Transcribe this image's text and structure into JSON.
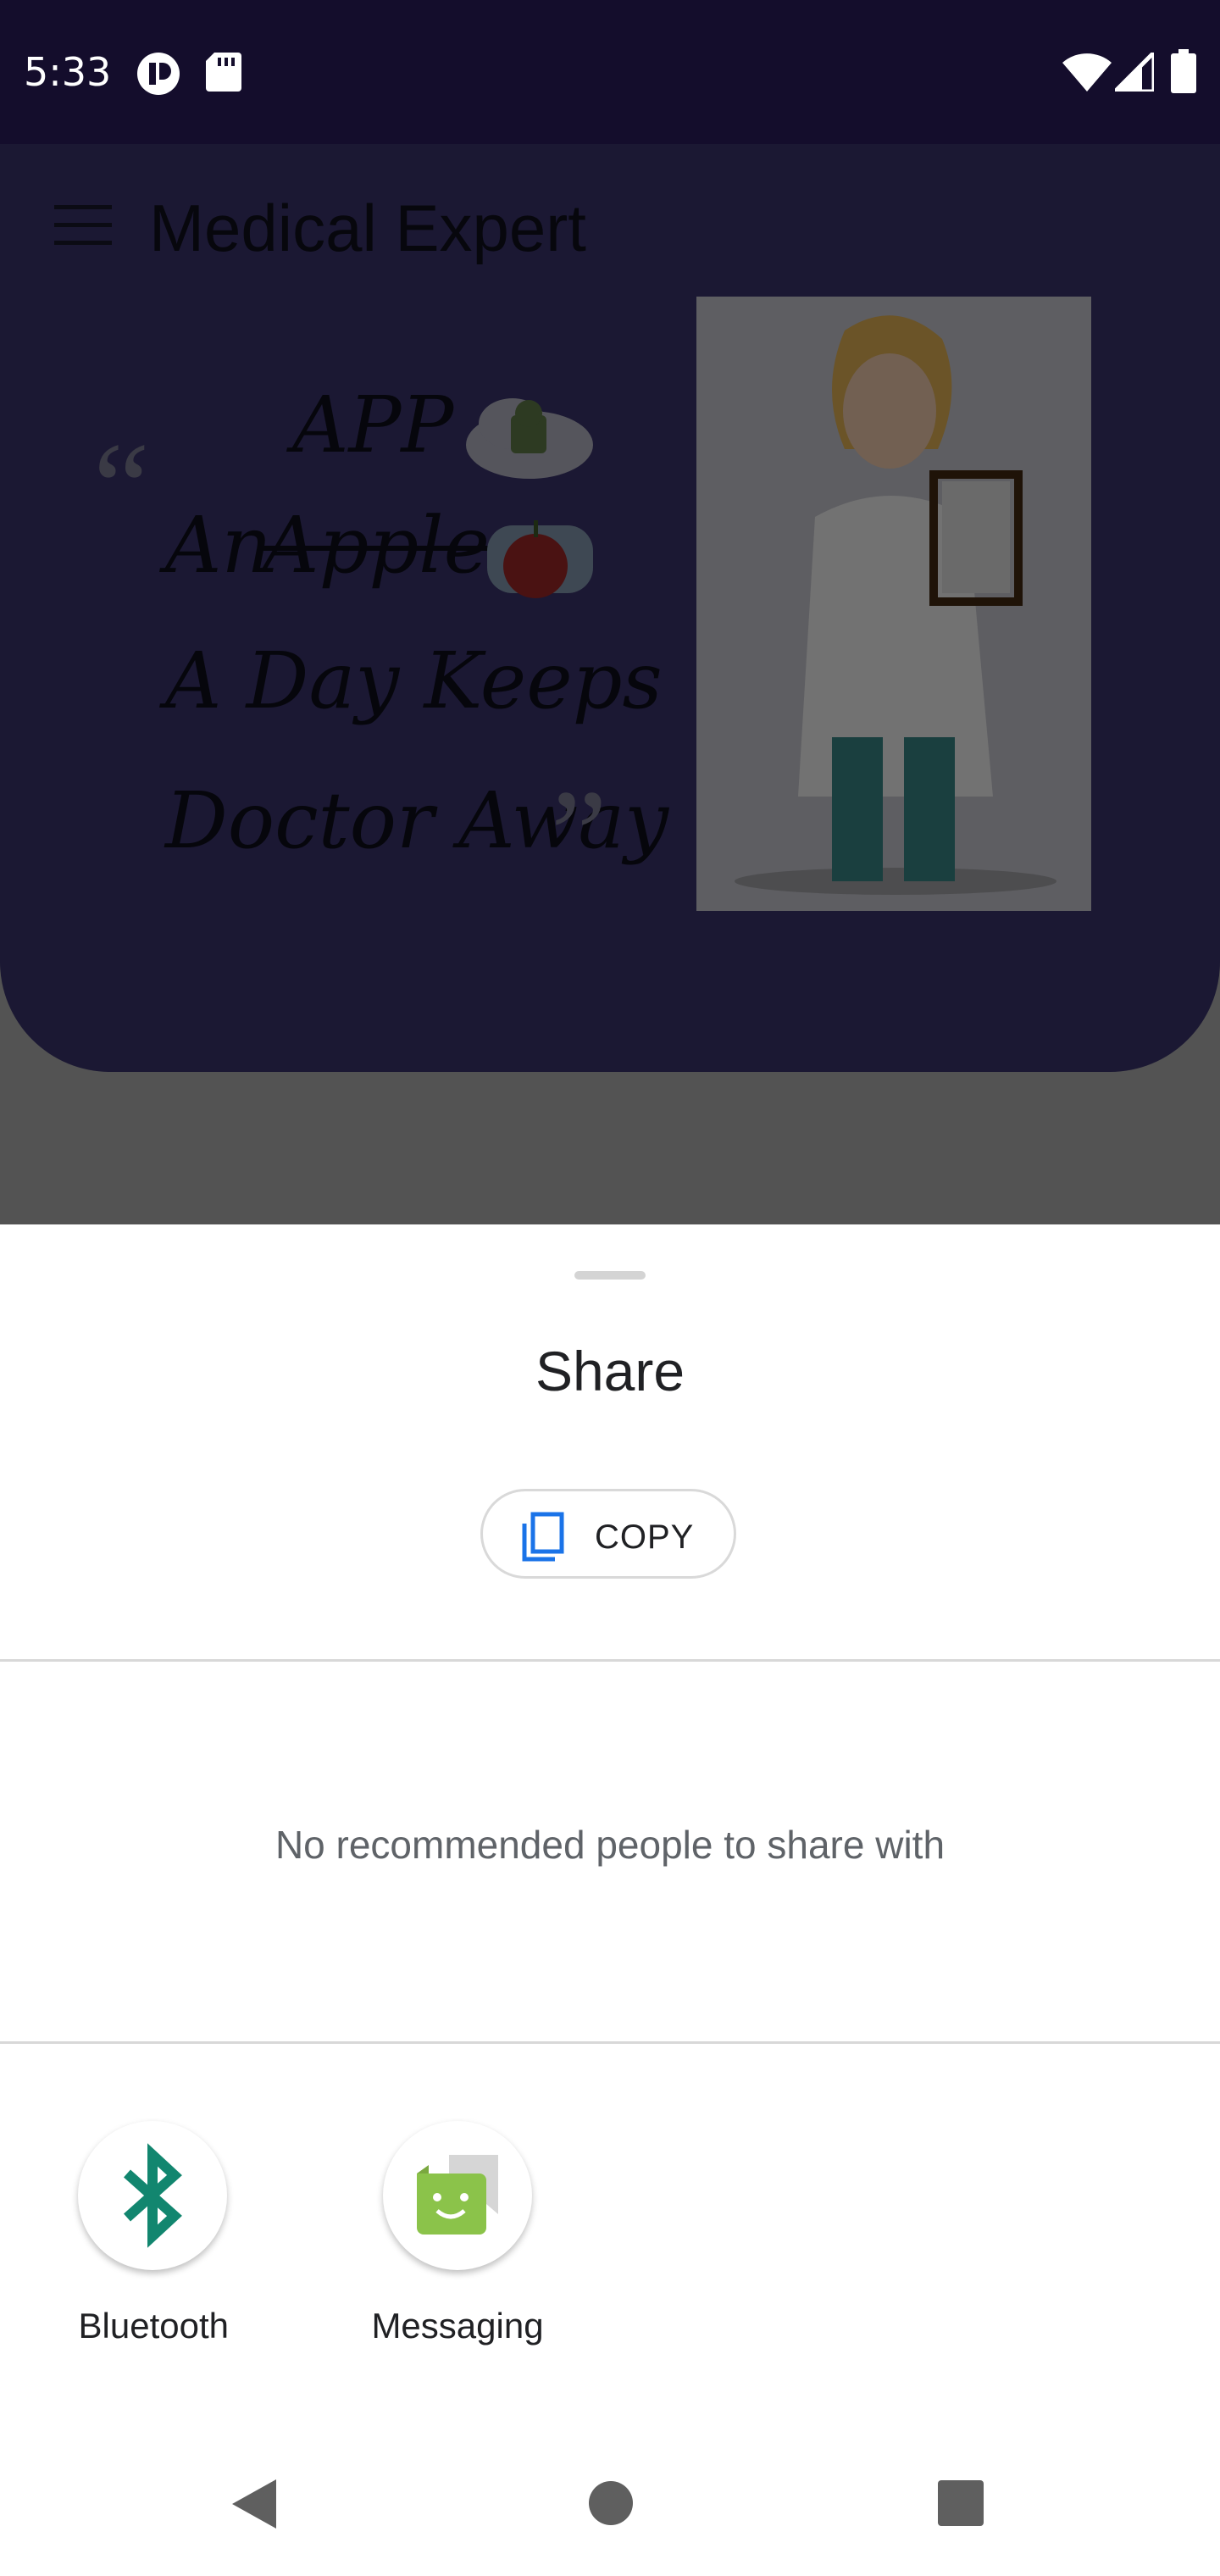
{
  "status_bar": {
    "time": "5:33",
    "icons": [
      "status-app-icon",
      "sd-card-icon",
      "wifi-icon",
      "signal-icon",
      "battery-icon"
    ]
  },
  "app": {
    "title": "Medical Expert",
    "quote": {
      "open_mark": "“",
      "line_app": "APP",
      "line_an": "An",
      "line_apple": "Apple",
      "line_day": "A Day Keeps",
      "line_doctor": "Doctor Away .",
      "close_mark": "”"
    }
  },
  "share_sheet": {
    "title": "Share",
    "copy_label": "COPY",
    "empty_people_text": "No recommended people to share with",
    "targets": [
      {
        "label": "Bluetooth",
        "icon": "bluetooth-icon",
        "color": "#12866f"
      },
      {
        "label": "Messaging",
        "icon": "messaging-icon",
        "color": "#8bc34a"
      }
    ]
  },
  "colors": {
    "status_bar_bg": "#140d2c",
    "banner_bg": "#1b1833",
    "copy_icon_color": "#1a73e8",
    "bluetooth_color": "#12866f",
    "messaging_color": "#8bc34a"
  },
  "nav": {
    "back_icon": "back-triangle-icon",
    "home_icon": "home-circle-icon",
    "recents_icon": "recents-square-icon"
  }
}
